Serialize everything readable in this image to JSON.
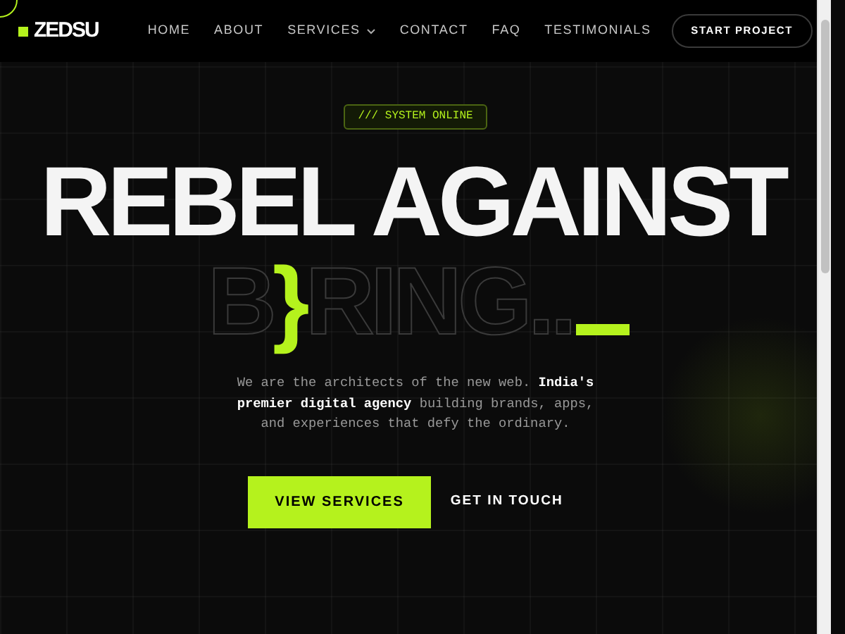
{
  "nav": {
    "logo": "ZEDSU",
    "links": [
      {
        "label": "HOME",
        "dropdown": false
      },
      {
        "label": "ABOUT",
        "dropdown": false
      },
      {
        "label": "SERVICES",
        "dropdown": true
      },
      {
        "label": "CONTACT",
        "dropdown": false
      },
      {
        "label": "FAQ",
        "dropdown": false
      },
      {
        "label": "TESTIMONIALS",
        "dropdown": false
      }
    ],
    "cta": "START PROJECT"
  },
  "hero": {
    "badge": "/// SYSTEM ONLINE",
    "headline": "REBEL AGAINST",
    "outline_word": {
      "before": "B",
      "brace": "}",
      "after": "RING.."
    },
    "intro": "We are the architects of the new web. **India's premier digital agency** building brands, apps, and experiences that defy the ordinary.",
    "buttons": [
      {
        "label": "VIEW SERVICES",
        "kind": "primary"
      },
      {
        "label": "GET IN TOUCH",
        "kind": "link"
      }
    ]
  }
}
